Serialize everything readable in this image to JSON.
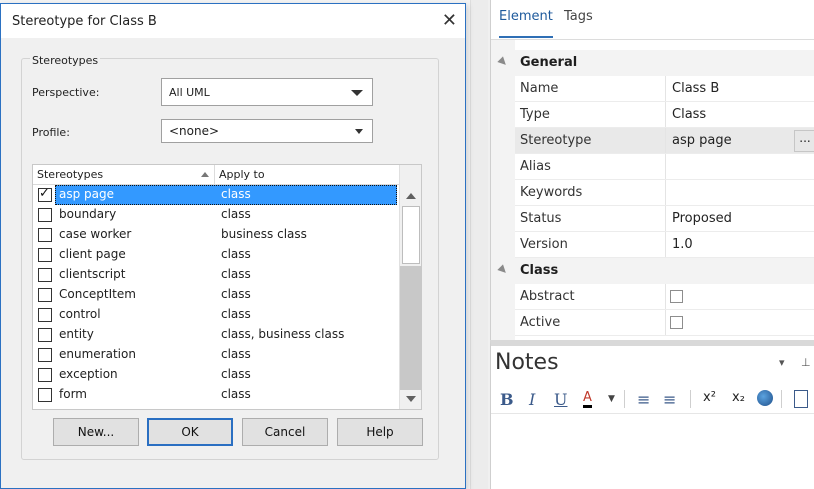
{
  "dialog": {
    "title": "Stereotype for Class B",
    "close_glyph": "✕",
    "group_label": "Stereotypes",
    "perspective_label": "Perspective:",
    "perspective_value": "All UML",
    "profile_label": "Profile:",
    "profile_value": "<none>",
    "columns": [
      "Stereotypes",
      "Apply to"
    ],
    "rows": [
      {
        "name": "asp page",
        "apply": "class",
        "checked": true,
        "selected": true
      },
      {
        "name": "boundary",
        "apply": "class",
        "checked": false,
        "selected": false
      },
      {
        "name": "case worker",
        "apply": "business class",
        "checked": false,
        "selected": false
      },
      {
        "name": "client page",
        "apply": "class",
        "checked": false,
        "selected": false
      },
      {
        "name": "clientscript",
        "apply": "class",
        "checked": false,
        "selected": false
      },
      {
        "name": "ConceptItem",
        "apply": "class",
        "checked": false,
        "selected": false
      },
      {
        "name": "control",
        "apply": "class",
        "checked": false,
        "selected": false
      },
      {
        "name": "entity",
        "apply": "class, business class",
        "checked": false,
        "selected": false
      },
      {
        "name": "enumeration",
        "apply": "class",
        "checked": false,
        "selected": false
      },
      {
        "name": "exception",
        "apply": "class",
        "checked": false,
        "selected": false
      },
      {
        "name": "form",
        "apply": "class",
        "checked": false,
        "selected": false
      }
    ],
    "buttons": {
      "new": "New...",
      "ok": "OK",
      "cancel": "Cancel",
      "help": "Help"
    }
  },
  "properties": {
    "tabs": [
      "Element",
      "Tags"
    ],
    "sections": [
      {
        "label": "General"
      },
      {
        "label": "Class"
      }
    ],
    "general_rows": [
      {
        "key": "Name",
        "value": "Class B"
      },
      {
        "key": "Type",
        "value": "Class"
      },
      {
        "key": "Stereotype",
        "value": "asp page"
      },
      {
        "key": "Alias",
        "value": ""
      },
      {
        "key": "Keywords",
        "value": ""
      },
      {
        "key": "Status",
        "value": "Proposed"
      },
      {
        "key": "Version",
        "value": "1.0"
      }
    ],
    "class_rows": [
      {
        "key": "Abstract"
      },
      {
        "key": "Active"
      }
    ],
    "ellipsis": "..."
  },
  "notes": {
    "title": "Notes",
    "dropdown_glyph": "▾",
    "pin_glyph": "⊥",
    "toolbar": [
      "B",
      "I",
      "U",
      "A",
      "≡",
      "≡",
      "x²",
      "x₂"
    ]
  }
}
